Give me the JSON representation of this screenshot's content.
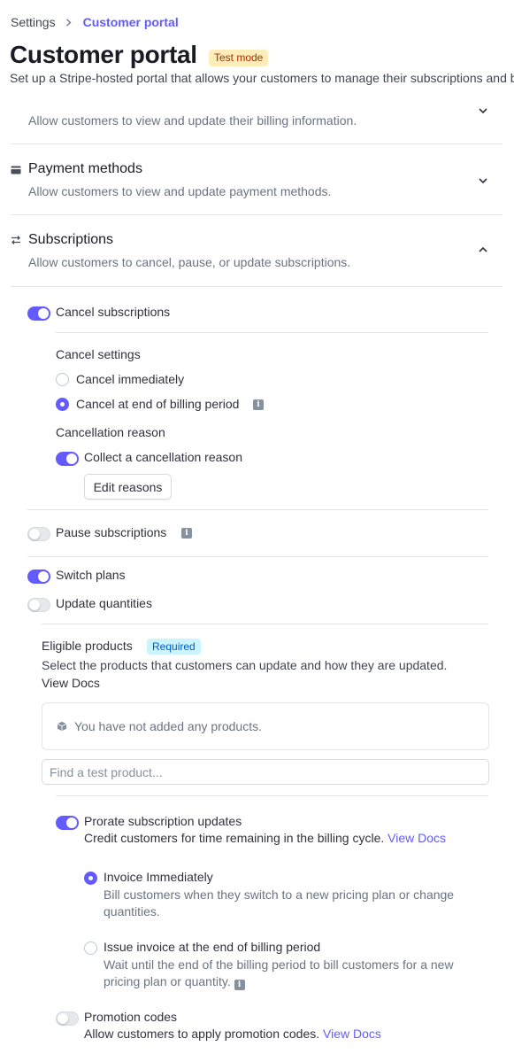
{
  "breadcrumb": {
    "root": "Settings",
    "current": "Customer portal"
  },
  "page": {
    "title": "Customer portal",
    "badge": "Test mode",
    "subtitle": "Set up a Stripe-hosted portal that allows your customers to manage their subscriptions and billing details."
  },
  "sections": {
    "billing_info": {
      "desc": "Allow customers to view and update their billing information."
    },
    "payment_methods": {
      "title": "Payment methods",
      "desc": "Allow customers to view and update payment methods."
    },
    "subscriptions": {
      "title": "Subscriptions",
      "desc": "Allow customers to cancel, pause, or update subscriptions."
    }
  },
  "cancel": {
    "label": "Cancel subscriptions",
    "enabled": true,
    "settings_heading": "Cancel settings",
    "options": [
      "Cancel immediately",
      "Cancel at end of billing period"
    ],
    "selected": "Cancel at end of billing period",
    "reason_heading": "Cancellation reason",
    "collect_reason_label": "Collect a cancellation reason",
    "collect_reason_enabled": true,
    "edit_reasons_button": "Edit reasons"
  },
  "pause": {
    "label": "Pause subscriptions",
    "enabled": false
  },
  "switch_plans": {
    "label": "Switch plans",
    "enabled": true
  },
  "update_quantities": {
    "label": "Update quantities",
    "enabled": false
  },
  "eligible_products": {
    "title": "Eligible products",
    "badge": "Required",
    "desc": "Select the products that customers can update and how they are updated.",
    "link": "View Docs",
    "empty": "You have not added any products.",
    "search_placeholder": "Find a test product..."
  },
  "prorate": {
    "label": "Prorate subscription updates",
    "enabled": true,
    "desc": "Credit customers for time remaining in the billing cycle.",
    "link": "View Docs",
    "options": [
      {
        "title": "Invoice Immediately",
        "desc": "Bill customers when they switch to a new pricing plan or change quantities.",
        "selected": true
      },
      {
        "title": "Issue invoice at the end of billing period",
        "desc": "Wait until the end of the billing period to bill customers for a new pricing plan or quantity.",
        "selected": false
      }
    ]
  },
  "promotion": {
    "label": "Promotion codes",
    "enabled": false,
    "desc": "Allow customers to apply promotion codes.",
    "link": "View Docs"
  },
  "colors": {
    "accent": "#635bff",
    "badge_test_bg": "#fcedb9",
    "badge_required_bg": "#cbf5fd"
  },
  "icons": [
    "chevron-right-icon",
    "credit-card-icon",
    "swap-arrows-icon",
    "chevron-down-icon",
    "chevron-up-icon",
    "info-icon",
    "cube-icon"
  ]
}
